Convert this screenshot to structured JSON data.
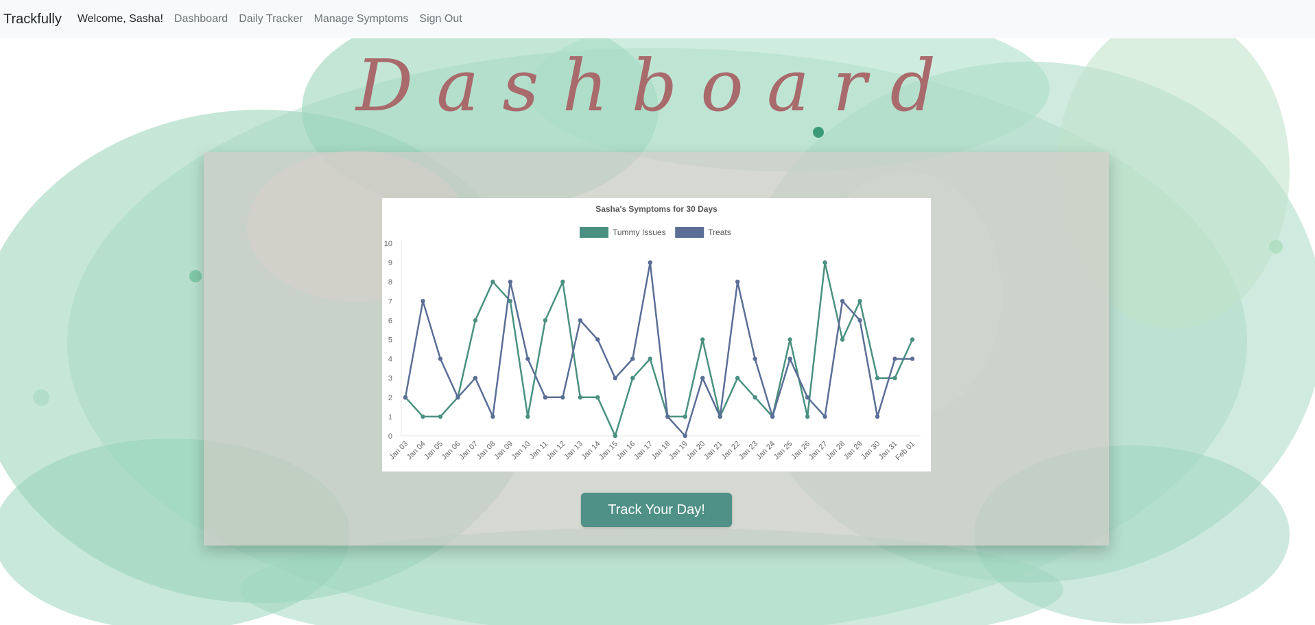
{
  "navbar": {
    "brand": "Trackfully",
    "welcome": "Welcome, Sasha!",
    "links": [
      "Dashboard",
      "Daily Tracker",
      "Manage Symptoms",
      "Sign Out"
    ]
  },
  "page": {
    "title": "Dashboard",
    "title_color": "#a96a6c",
    "button_label": "Track Your Day!",
    "button_color": "#4f9087"
  },
  "chart_data": {
    "type": "line",
    "title": "Sasha's Symptoms for 30 Days",
    "categories": [
      "Jan 03",
      "Jan 04",
      "Jan 05",
      "Jan 06",
      "Jan 07",
      "Jan 08",
      "Jan 09",
      "Jan 10",
      "Jan 11",
      "Jan 12",
      "Jan 13",
      "Jan 14",
      "Jan 15",
      "Jan 16",
      "Jan 17",
      "Jan 18",
      "Jan 19",
      "Jan 20",
      "Jan 21",
      "Jan 22",
      "Jan 23",
      "Jan 24",
      "Jan 25",
      "Jan 26",
      "Jan 27",
      "Jan 28",
      "Jan 29",
      "Jan 30",
      "Jan 31",
      "Feb 01"
    ],
    "series": [
      {
        "name": "Tummy Issues",
        "color": "#4a9080",
        "values": [
          2,
          1,
          1,
          2,
          6,
          8,
          7,
          1,
          6,
          8,
          2,
          2,
          0,
          3,
          4,
          1,
          1,
          5,
          1,
          3,
          2,
          1,
          5,
          1,
          9,
          5,
          7,
          3,
          3,
          5
        ]
      },
      {
        "name": "Treats",
        "color": "#5a6e96",
        "values": [
          2,
          7,
          4,
          2,
          3,
          1,
          8,
          4,
          2,
          2,
          6,
          5,
          3,
          4,
          9,
          1,
          0,
          3,
          1,
          8,
          4,
          1,
          4,
          2,
          1,
          7,
          6,
          1,
          4,
          4
        ]
      }
    ],
    "ylim": [
      0,
      10
    ],
    "yticks": [
      "0",
      "1",
      "2",
      "3",
      "4",
      "5",
      "6",
      "7",
      "8",
      "9",
      "10"
    ],
    "legend": "top",
    "grid": false
  }
}
